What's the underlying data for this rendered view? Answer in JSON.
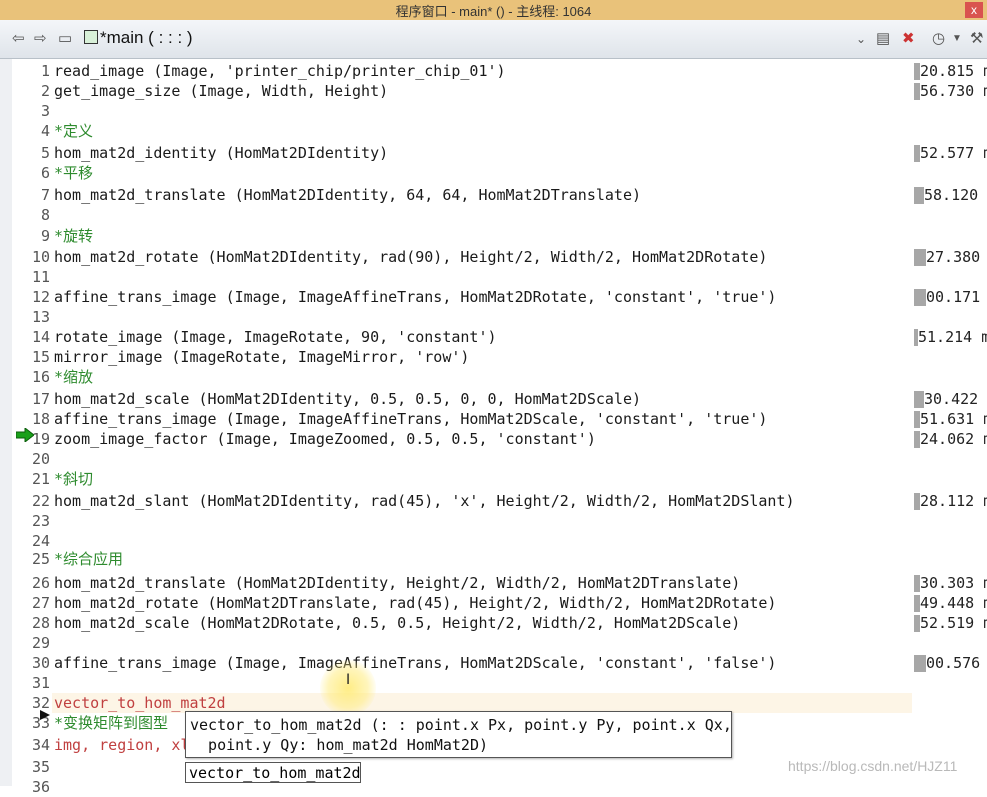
{
  "window": {
    "title": "程序窗口 - main* () - 主线程: 1064",
    "close_label": "x"
  },
  "toolbar": {
    "tab_label": "*main ( : : : )"
  },
  "lines": [
    {
      "n": "1",
      "code": "read_image (Image, 'printer_chip/printer_chip_01')",
      "type": "code",
      "time": "20.815 ms",
      "bar": 6
    },
    {
      "n": "2",
      "code": "get_image_size (Image, Width, Height)",
      "type": "code",
      "time": "56.730 ms",
      "bar": 6
    },
    {
      "n": "3",
      "code": "",
      "type": "code",
      "time": "",
      "bar": 0
    },
    {
      "n": "4",
      "code": "*定义",
      "type": "comment",
      "time": "",
      "bar": 0
    },
    {
      "n": "5",
      "code": "hom_mat2d_identity (HomMat2DIdentity)",
      "type": "code",
      "time": "52.577 ms",
      "bar": 6
    },
    {
      "n": "6",
      "code": "*平移",
      "type": "comment",
      "time": "",
      "bar": 0
    },
    {
      "n": "7",
      "code": "hom_mat2d_translate (HomMat2DIdentity, 64, 64, HomMat2DTranslate)",
      "type": "code",
      "time": "58.120 ms",
      "bar": 10
    },
    {
      "n": "8",
      "code": "",
      "type": "code",
      "time": "",
      "bar": 0
    },
    {
      "n": "9",
      "code": "*旋转",
      "type": "comment",
      "time": "",
      "bar": 0
    },
    {
      "n": "10",
      "code": "hom_mat2d_rotate (HomMat2DIdentity, rad(90), Height/2, Width/2, HomMat2DRotate)",
      "type": "code",
      "time": "27.380 ms",
      "bar": 12
    },
    {
      "n": "11",
      "code": "",
      "type": "code",
      "time": "",
      "bar": 0
    },
    {
      "n": "12",
      "code": "affine_trans_image (Image, ImageAffineTrans, HomMat2DRotate, 'constant', 'true')",
      "type": "code",
      "time": "00.171 ms",
      "bar": 12
    },
    {
      "n": "13",
      "code": "",
      "type": "code",
      "time": "",
      "bar": 0
    },
    {
      "n": "14",
      "code": "rotate_image (Image, ImageRotate, 90, 'constant')",
      "type": "code",
      "time": "51.214 ms",
      "bar": 4
    },
    {
      "n": "15",
      "code": "mirror_image (ImageRotate, ImageMirror, 'row')",
      "type": "code",
      "time": "          -",
      "bar": 0
    },
    {
      "n": "16",
      "code": "*缩放",
      "type": "comment",
      "time": "",
      "bar": 0
    },
    {
      "n": "17",
      "code": "hom_mat2d_scale (HomMat2DIdentity, 0.5, 0.5, 0, 0, HomMat2DScale)",
      "type": "code",
      "time": "30.422 ms",
      "bar": 10
    },
    {
      "n": "18",
      "code": "affine_trans_image (Image, ImageAffineTrans, HomMat2DScale, 'constant', 'true')",
      "type": "code",
      "time": "51.631 ms",
      "bar": 6
    },
    {
      "n": "19",
      "code": "zoom_image_factor (Image, ImageZoomed, 0.5, 0.5, 'constant')",
      "type": "code",
      "time": "24.062 ms",
      "bar": 6
    },
    {
      "n": "20",
      "code": "",
      "type": "code",
      "time": "",
      "bar": 0
    },
    {
      "n": "21",
      "code": "*斜切",
      "type": "comment",
      "time": "",
      "bar": 0
    },
    {
      "n": "22",
      "code": "hom_mat2d_slant (HomMat2DIdentity, rad(45), 'x', Height/2, Width/2, HomMat2DSlant)",
      "type": "code",
      "time": "28.112 ms",
      "bar": 6
    },
    {
      "n": "23",
      "code": "",
      "type": "code",
      "time": "",
      "bar": 0
    },
    {
      "n": "24",
      "code": "",
      "type": "code",
      "time": "",
      "bar": 0
    },
    {
      "n": "25",
      "code": "*综合应用",
      "type": "comment",
      "time": "",
      "bar": 0
    },
    {
      "n": "26",
      "code": "hom_mat2d_translate (HomMat2DIdentity, Height/2, Width/2, HomMat2DTranslate)",
      "type": "code",
      "time": "30.303 ms",
      "bar": 6
    },
    {
      "n": "27",
      "code": "hom_mat2d_rotate (HomMat2DTranslate, rad(45), Height/2, Width/2, HomMat2DRotate)",
      "type": "code",
      "time": "49.448 ms",
      "bar": 6
    },
    {
      "n": "28",
      "code": "hom_mat2d_scale (HomMat2DRotate, 0.5, 0.5, Height/2, Width/2, HomMat2DScale)",
      "type": "code",
      "time": "52.519 ms",
      "bar": 6
    },
    {
      "n": "29",
      "code": "",
      "type": "code",
      "time": "",
      "bar": 0
    },
    {
      "n": "30",
      "code": "affine_trans_image (Image, ImageAffineTrans, HomMat2DScale, 'constant', 'false')",
      "type": "code",
      "time": "00.576 ms",
      "bar": 12
    },
    {
      "n": "31",
      "code": "",
      "type": "code",
      "time": "",
      "bar": 0
    },
    {
      "n": "32",
      "code": "vector_to_hom_mat2d",
      "type": "typing",
      "time": "",
      "bar": 0
    },
    {
      "n": "33",
      "code": "*变换矩阵到图型",
      "type": "comment",
      "time": "",
      "bar": 0
    },
    {
      "n": "34",
      "code": "img, region, xld",
      "type": "typing",
      "time": "",
      "bar": 0
    },
    {
      "n": "35",
      "code": "",
      "type": "code",
      "time": "",
      "bar": 0
    },
    {
      "n": "36",
      "code": "",
      "type": "code",
      "time": "",
      "bar": 0
    }
  ],
  "tooltip": {
    "line1": "vector_to_hom_mat2d (: : point.x Px, point.y Py, point.x Qx,",
    "line2": "  point.y Qy: hom_mat2d HomMat2D)"
  },
  "completion": {
    "item": "vector_to_hom_mat2d"
  },
  "watermark": "https://blog.csdn.net/HJZ11",
  "colors": {
    "title_bar": "#e9c27a",
    "comment": "#2e8b2e",
    "exec_arrow": "#1aa01a"
  }
}
